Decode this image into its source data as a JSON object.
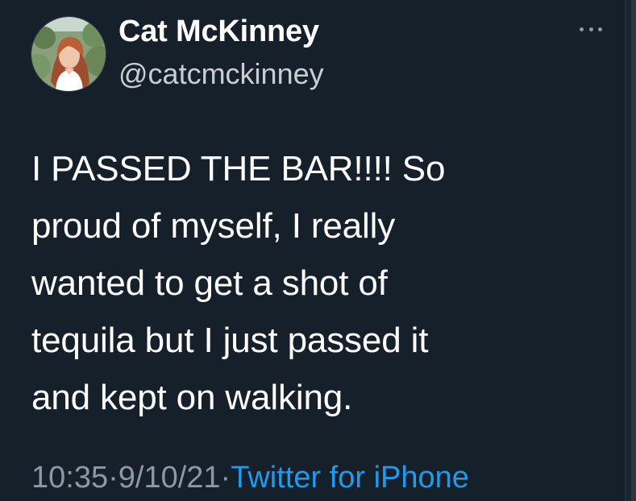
{
  "tweet": {
    "author": {
      "name": "Cat McKinney",
      "handle": "@catcmckinney"
    },
    "text": "I PASSED THE BAR!!!! So\nproud of myself, I really\nwanted to get a shot of\ntequila but I just passed it\nand kept on walking.",
    "timestamp": {
      "time": "10:35",
      "separator_1": " · ",
      "date": "9/10/21",
      "separator_2": " · ",
      "source": "Twitter for iPhone"
    },
    "more_icon": "more-horizontal-icon"
  },
  "colors": {
    "background": "#15202b",
    "primary_text": "#ffffff",
    "secondary_text": "#8b98a5",
    "link": "#1d9bf0"
  }
}
